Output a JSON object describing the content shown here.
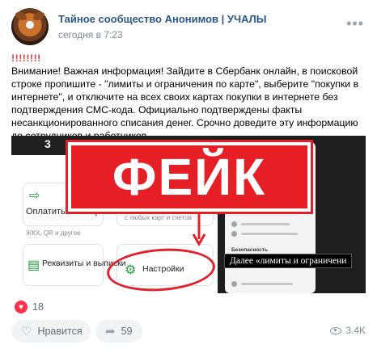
{
  "post": {
    "group_name": "Тайное сообщество Анонимов | УЧАЛЫ",
    "time": "сегодня в 7:23",
    "more_icon": "more-horizontal-icon",
    "exclamations": "!!!!!!!!",
    "body": "Внимание! Важная информация! Зайдите в Сбербанк онлайн, в поисковой строке пропишите - \"лимиты и ограничения по карте\", выберите \"покупки в интернете\", и отключите на всех своих картах покупки в интернете без подтверждения СМС-кода. Официально подтверждены факты несанкционированного списания денег. Срочно доведите эту информацию до сотрудников и работников."
  },
  "media": {
    "stamp_text": "ФЕЙК",
    "stamp_color": "#e61e25",
    "left_panel": {
      "top_number": "3",
      "pay_title": "Оплатить или перевести",
      "pay_sub": "ЖКХ, QR и другое",
      "cards_sub": "с любых карт и счетов",
      "requisites_title": "Реквизиты и выписки",
      "settings_label": "Настройки"
    },
    "right_panel": {
      "section_label": "Безопасность",
      "caption": "Далее «лимиты и ограничени"
    }
  },
  "reactions": {
    "heart_icon": "heart-icon",
    "count": "18"
  },
  "actions": {
    "like_label": "Нравится",
    "like_icon": "heart-outline-icon",
    "share_count": "59",
    "share_icon": "share-icon",
    "views": "3.4K",
    "views_icon": "eye-icon"
  },
  "colors": {
    "link": "#2a5885",
    "muted": "#818c99",
    "reaction": "#ff3347",
    "sber_green": "#21a038"
  }
}
